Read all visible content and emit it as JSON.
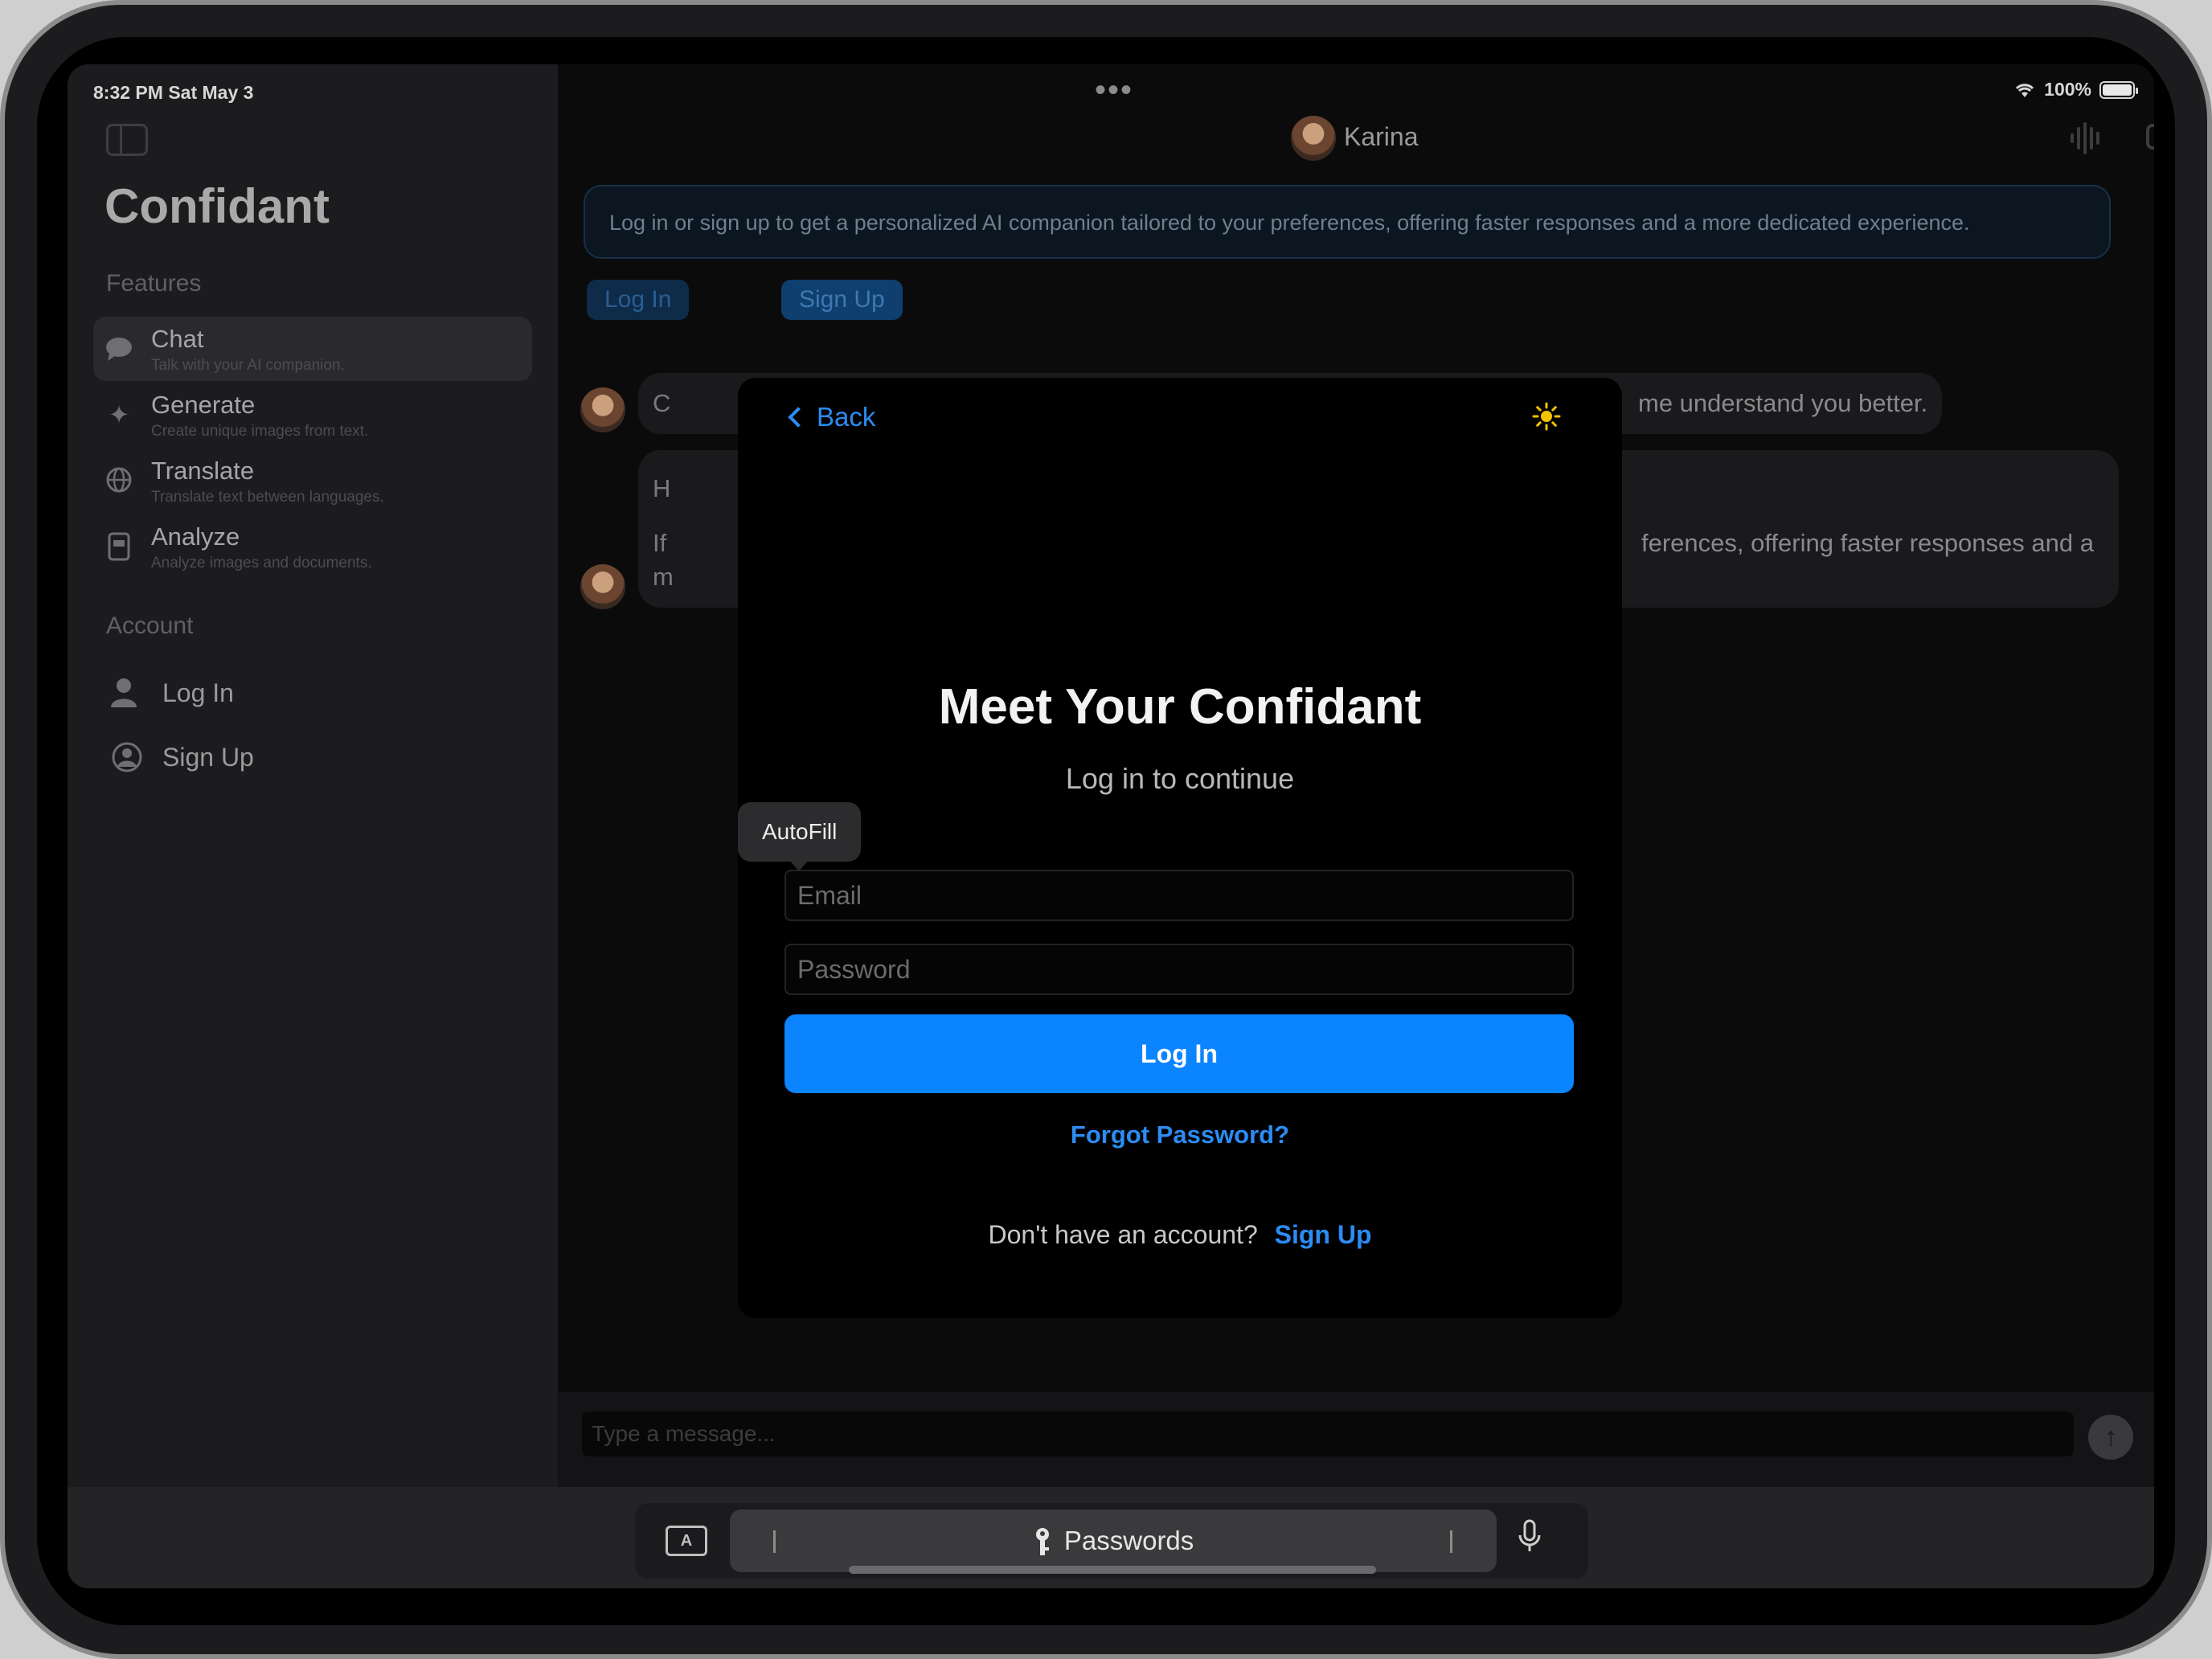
{
  "status_bar": {
    "time": "8:32 PM  Sat May 3",
    "battery": "100%",
    "menu_dots": "•••"
  },
  "sidebar": {
    "app_title": "Confidant",
    "features_label": "Features",
    "items": [
      {
        "label": "Chat",
        "subtitle": "Talk with your AI companion.",
        "icon": "chat-bubble-icon",
        "active": true
      },
      {
        "label": "Generate",
        "subtitle": "Create unique images from text.",
        "icon": "sparkles-icon",
        "active": false
      },
      {
        "label": "Translate",
        "subtitle": "Translate text between languages.",
        "icon": "globe-icon",
        "active": false
      },
      {
        "label": "Analyze",
        "subtitle": "Analyze images and documents.",
        "icon": "document-icon",
        "active": false
      }
    ],
    "account_label": "Account",
    "account_items": [
      {
        "label": "Log In",
        "icon": "person-icon"
      },
      {
        "label": "Sign Up",
        "icon": "person-add-icon"
      }
    ]
  },
  "chat_header": {
    "contact_name": "Karina"
  },
  "banner": {
    "text": "Log in or sign up to get a personalized AI companion tailored to your preferences, offering faster responses and a more dedicated experience."
  },
  "banner_buttons": {
    "login": "Log In",
    "signup": "Sign Up"
  },
  "messages": [
    {
      "visible_start": "C",
      "visible_end": "me understand you better."
    },
    {
      "visible_start_lines": [
        "H",
        "If",
        "m"
      ],
      "visible_end": "ferences, offering faster responses and a"
    }
  ],
  "composer": {
    "placeholder": "Type a message...",
    "send_icon": "arrow-up-icon"
  },
  "keyboard_bar": {
    "passwords_label": "Passwords",
    "mic_icon": "microphone-icon",
    "keyboard_icon_letter": "A"
  },
  "login_sheet": {
    "back_label": "Back",
    "theme_icon": "sun-icon",
    "title": "Meet Your Confidant",
    "subtitle": "Log in to continue",
    "autofill_label": "AutoFill",
    "email_placeholder": "Email",
    "password_placeholder": "Password",
    "login_button": "Log In",
    "forgot_password": "Forgot Password?",
    "no_account_text": "Don't have an account?",
    "signup_link": "Sign Up"
  },
  "colors": {
    "accent": "#0a84ff",
    "sun": "#f2c200",
    "background": "#000000"
  }
}
